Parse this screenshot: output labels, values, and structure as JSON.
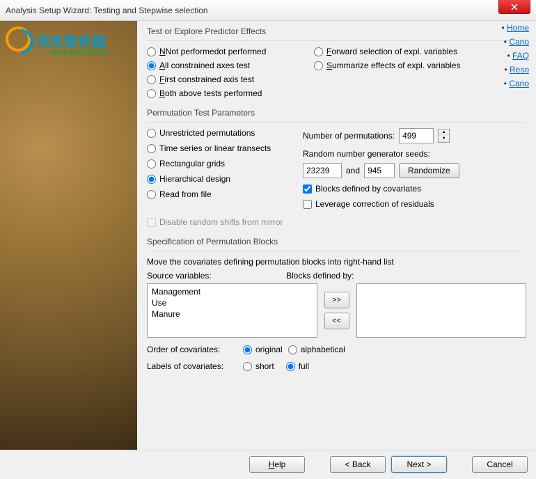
{
  "titlebar": {
    "title": "Analysis Setup Wizard: Testing and Stepwise selection"
  },
  "watermark": {
    "text1": "河东软件园",
    "text2": "www.pc0359.cn"
  },
  "sideLinks": {
    "items": [
      "Home",
      "Cano",
      "FAQ",
      "Reso",
      "Cano"
    ]
  },
  "group1": {
    "title": "Test or Explore Predictor Effects",
    "notPerformed": "Not performed",
    "allConstrained": "All constrained axes test",
    "firstConstrained": "First constrained axis test",
    "bothAbove": "Both above tests performed",
    "forwardSelection": "Forward selection of expl. variables",
    "summarize": "Summarize effects of expl. variables"
  },
  "group2": {
    "title": "Permutation Test Parameters",
    "unrestricted": "Unrestricted permutations",
    "timeSeries": "Time series or linear transects",
    "rectGrids": "Rectangular grids",
    "hierarchical": "Hierarchical design",
    "readFile": "Read from file",
    "numPermsLabel": "Number of permutations:",
    "numPerms": "499",
    "seedsLabel": "Random number generator seeds:",
    "seed1": "23239",
    "seedAnd": "and",
    "seed2": "945",
    "randomizeBtn": "Randomize",
    "blocksCovariates": "Blocks defined by covariates",
    "leverageCorrection": "Leverage correction of residuals",
    "disableMirror": "Disable random shifts from mirror"
  },
  "group3": {
    "title": "Specification of Permutation Blocks",
    "moveLabel": "Move the covariates defining permutation blocks into right-hand list",
    "sourceLabel": "Source variables:",
    "blocksLabel": "Blocks defined by:",
    "sourceItems": [
      "Management",
      "Use",
      "Manure"
    ],
    "orderLabel": "Order of covariates:",
    "orderOriginal": "original",
    "orderAlpha": "alphabetical",
    "labelsLabel": "Labels of covariates:",
    "labelsShort": "short",
    "labelsFull": "full"
  },
  "buttons": {
    "help": "Help",
    "back": "< Back",
    "next": "Next >",
    "cancel": "Cancel",
    "moveRight": ">>",
    "moveLeft": "<<"
  }
}
